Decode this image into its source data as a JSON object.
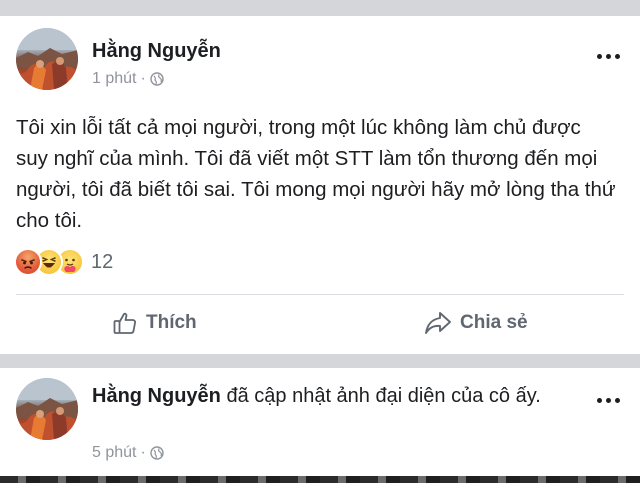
{
  "post": {
    "author": "Hằng Nguyễn",
    "time": "1 phút",
    "separator": "·",
    "privacy_icon": "globe-icon",
    "text": "Tôi xin lỗi tất cả mọi người, trong một lúc không làm chủ được suy nghĩ của mình. Tôi đã viết một STT làm tổn thương đến mọi người, tôi đã biết tôi sai. Tôi mong mọi người hãy mở lòng tha thứ cho tôi.",
    "reactions": {
      "icons": [
        "angry-reaction-icon",
        "haha-reaction-icon",
        "care-reaction-icon"
      ],
      "count": "12"
    },
    "actions": {
      "like_label": "Thích",
      "share_label": "Chia sẻ"
    }
  },
  "update": {
    "author": "Hằng Nguyễn",
    "action_text": "đã cập nhật ảnh đại diện của cô ấy.",
    "time": "5 phút",
    "separator": "·",
    "privacy_icon": "globe-icon"
  },
  "colors": {
    "background": "#d4d6da",
    "card": "#ffffff",
    "primary_text": "#1c1e21",
    "secondary_text": "#90949c",
    "action_text": "#606770"
  }
}
